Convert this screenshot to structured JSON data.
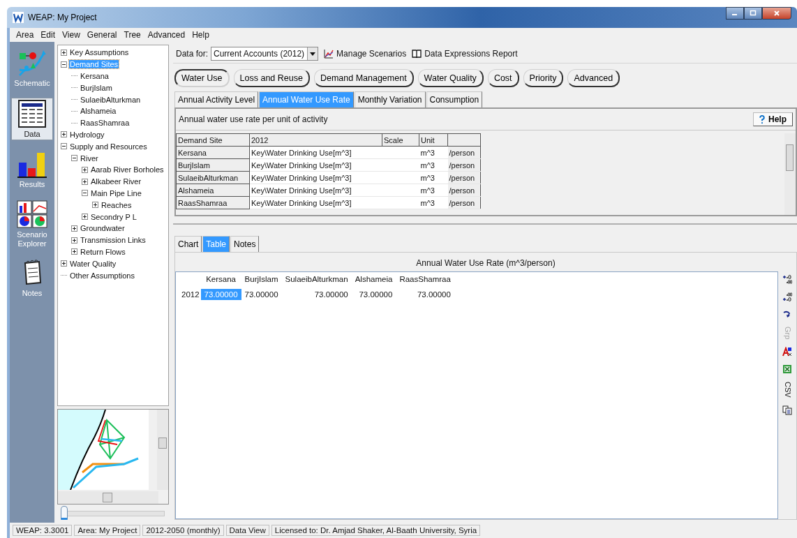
{
  "window": {
    "title": "WEAP: My Project"
  },
  "menu": [
    "Area",
    "Edit",
    "View",
    "General",
    "Tree",
    "Advanced",
    "Help"
  ],
  "views": [
    {
      "label": "Schematic",
      "selected": false
    },
    {
      "label": "Data",
      "selected": true
    },
    {
      "label": "Results",
      "selected": false
    },
    {
      "label": "Scenario Explorer",
      "selected": false
    },
    {
      "label": "Notes",
      "selected": false
    }
  ],
  "tree": [
    {
      "label": "Key Assumptions",
      "expanded": false,
      "selected": false
    },
    {
      "label": "Demand Sites",
      "expanded": true,
      "selected": true,
      "children": [
        {
          "label": "Kersana",
          "selected": false
        },
        {
          "label": "BurjIslam",
          "selected": false
        },
        {
          "label": "SulaeibAlturkman",
          "selected": false
        },
        {
          "label": "Alshameia",
          "selected": false
        },
        {
          "label": "RaasShamraa",
          "selected": false
        }
      ]
    },
    {
      "label": "Hydrology",
      "expanded": false,
      "selected": false
    },
    {
      "label": "Supply and Resources",
      "expanded": true,
      "selected": false,
      "children": [
        {
          "label": "River",
          "expanded": true,
          "selected": false,
          "children": [
            {
              "label": "Aarab River Borholes",
              "expanded": false,
              "selected": false
            },
            {
              "label": "Alkabeer River",
              "expanded": false,
              "selected": false
            },
            {
              "label": "Main Pipe Line",
              "expanded": true,
              "selected": false,
              "children": [
                {
                  "label": "Reaches",
                  "expanded": false,
                  "selected": false
                }
              ]
            },
            {
              "label": "Secondry P L",
              "expanded": false,
              "selected": false
            }
          ]
        },
        {
          "label": "Groundwater",
          "expanded": false,
          "selected": false
        },
        {
          "label": "Transmission Links",
          "expanded": false,
          "selected": false
        },
        {
          "label": "Return Flows",
          "expanded": false,
          "selected": false
        }
      ]
    },
    {
      "label": "Water Quality",
      "expanded": false,
      "selected": false
    },
    {
      "label": "Other Assumptions",
      "selected": false
    }
  ],
  "zoom_slider": {
    "level": 0
  },
  "data_for": {
    "label": "Data for:",
    "value": "Current Accounts (2012)"
  },
  "links": [
    "Manage Scenarios",
    "Data Expressions Report"
  ],
  "categories": [
    {
      "label": "Water Use",
      "selected": true
    },
    {
      "label": "Loss and Reuse",
      "selected": false
    },
    {
      "label": "Demand Management",
      "selected": false
    },
    {
      "label": "Water Quality",
      "selected": false
    },
    {
      "label": "Cost",
      "selected": false
    },
    {
      "label": "Priority",
      "selected": false
    },
    {
      "label": "Advanced",
      "selected": false
    }
  ],
  "subtabs": [
    {
      "label": "Annual Activity Level",
      "selected": false
    },
    {
      "label": "Annual Water Use Rate",
      "selected": true
    },
    {
      "label": "Monthly Variation",
      "selected": false
    },
    {
      "label": "Consumption",
      "selected": false
    }
  ],
  "description": "Annual water use rate per unit of activity",
  "help_button": "Help",
  "table": {
    "columns": [
      "Demand Site",
      "2012",
      "Scale",
      "Unit"
    ],
    "rows": [
      {
        "site": "Kersana",
        "expression": "Key\\Water Drinking Use[m^3]",
        "unit": "m^3",
        "per": "/person"
      },
      {
        "site": "BurjIslam",
        "expression": "Key\\Water Drinking Use[m^3]",
        "unit": "m^3",
        "per": "/person"
      },
      {
        "site": "SulaeibAlturkman",
        "expression": "Key\\Water Drinking Use[m^3]",
        "unit": "m^3",
        "per": "/person"
      },
      {
        "site": "Alshameia",
        "expression": "Key\\Water Drinking Use[m^3]",
        "unit": "m^3",
        "per": "/person"
      },
      {
        "site": "RaasShamraa",
        "expression": "Key\\Water Drinking Use[m^3]",
        "unit": "m^3",
        "per": "/person"
      }
    ]
  },
  "result_tabs": [
    {
      "label": "Chart",
      "selected": false
    },
    {
      "label": "Table",
      "selected": true
    },
    {
      "label": "Notes",
      "selected": false
    }
  ],
  "result": {
    "title": "Annual Water Use Rate (m^3/person)",
    "columns": [
      "Kersana",
      "BurjIslam",
      "SulaeibAlturkman",
      "Alshameia",
      "RaasShamraa"
    ],
    "rows": [
      {
        "year": "2012",
        "values": [
          {
            "text": "73.00000",
            "selected": true
          },
          {
            "text": "73.00000",
            "selected": false
          },
          {
            "text": "73.00000",
            "selected": false
          },
          {
            "text": "73.00000",
            "selected": false
          },
          {
            "text": "73.00000",
            "selected": false
          }
        ]
      }
    ]
  },
  "result_toolbar": {
    "grp_label": "Grp",
    "grp_disabled": true,
    "csv_label": "CSV"
  },
  "status_bar": [
    "WEAP: 3.3001",
    "Area: My Project",
    "2012-2050 (monthly)",
    "Data View",
    "Licensed to: Dr. Amjad Shaker, Al-Baath University, Syria"
  ]
}
